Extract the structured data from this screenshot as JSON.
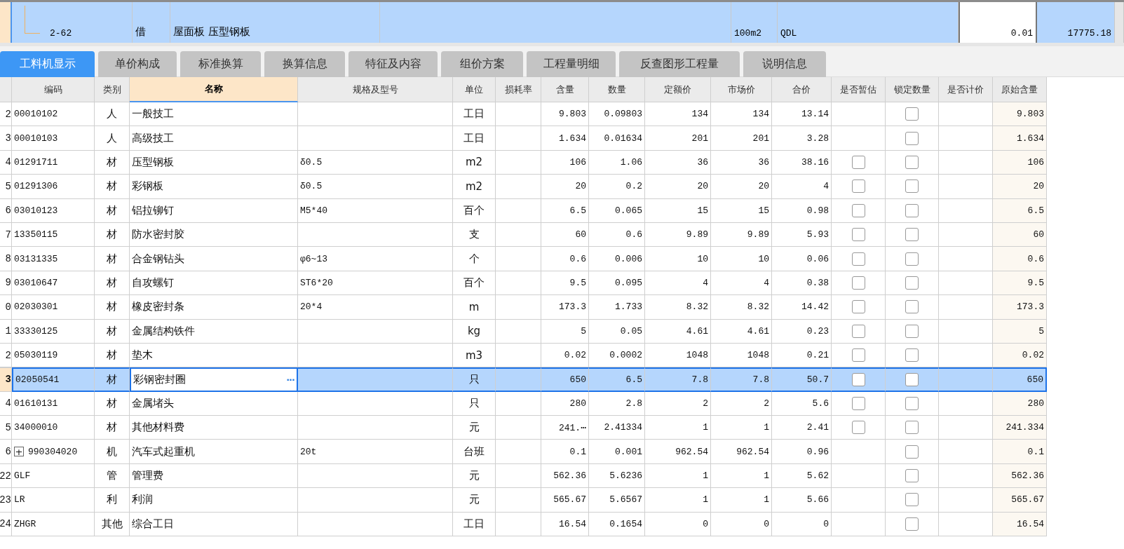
{
  "parent_row": {
    "code": "2-62",
    "type": "借",
    "name": "屋面板 压型钢板",
    "unit": "100m2",
    "column_6": "QDL",
    "column_7": "0.01",
    "column_8": "17775.18"
  },
  "tabs": [
    {
      "label": "工料机显示",
      "selected": true
    },
    {
      "label": "单价构成",
      "selected": false
    },
    {
      "label": "标准换算",
      "selected": false
    },
    {
      "label": "换算信息",
      "selected": false
    },
    {
      "label": "特征及内容",
      "selected": false
    },
    {
      "label": "组价方案",
      "selected": false
    },
    {
      "label": "工程量明细",
      "selected": false
    },
    {
      "label": "反查图形工程量",
      "selected": false
    },
    {
      "label": "说明信息",
      "selected": false
    }
  ],
  "table": {
    "columns": [
      {
        "label": "编码",
        "selected": false
      },
      {
        "label": "类别",
        "selected": false
      },
      {
        "label": "名称",
        "selected": true
      },
      {
        "label": "规格及型号",
        "selected": false
      },
      {
        "label": "单位",
        "selected": false
      },
      {
        "label": "损耗率",
        "selected": false
      },
      {
        "label": "含量",
        "selected": false
      },
      {
        "label": "数量",
        "selected": false
      },
      {
        "label": "定额价",
        "selected": false
      },
      {
        "label": "市场价",
        "selected": false
      },
      {
        "label": "合价",
        "selected": false
      },
      {
        "label": "是否暂估",
        "selected": false
      },
      {
        "label": "锁定数量",
        "selected": false
      },
      {
        "label": "是否计价",
        "selected": false
      },
      {
        "label": "原始含量",
        "selected": false
      }
    ],
    "rows": [
      {
        "number": "2",
        "code": "00010102",
        "type": "人",
        "name": "一般技工",
        "unit": "工日",
        "content": "9.803",
        "quantity": "0.09803",
        "fixed_price": "134",
        "market_price": "134",
        "total": "13.14",
        "lock": false,
        "original": "9.803",
        "selected": false
      },
      {
        "number": "3",
        "code": "00010103",
        "type": "人",
        "name": "高级技工",
        "unit": "工日",
        "content": "1.634",
        "quantity": "0.01634",
        "fixed_price": "201",
        "market_price": "201",
        "total": "3.28",
        "lock": false,
        "original": "1.634",
        "selected": false
      },
      {
        "number": "4",
        "code": "01291711",
        "type": "材",
        "name": "压型钢板",
        "spec": "δ0.5",
        "unit": "m2",
        "content": "106",
        "quantity": "1.06",
        "fixed_price": "36",
        "market_price": "36",
        "total": "38.16",
        "provisional": false,
        "lock": false,
        "original": "106",
        "selected": false
      },
      {
        "number": "5",
        "code": "01291306",
        "type": "材",
        "name": "彩钢板",
        "spec": "δ0.5",
        "unit": "m2",
        "content": "20",
        "quantity": "0.2",
        "fixed_price": "20",
        "market_price": "20",
        "total": "4",
        "provisional": false,
        "lock": false,
        "original": "20",
        "selected": false
      },
      {
        "number": "6",
        "code": "03010123",
        "type": "材",
        "name": "铝拉铆钉",
        "spec": "M5*40",
        "unit": "百个",
        "content": "6.5",
        "quantity": "0.065",
        "fixed_price": "15",
        "market_price": "15",
        "total": "0.98",
        "provisional": false,
        "lock": false,
        "original": "6.5",
        "selected": false
      },
      {
        "number": "7",
        "code": "13350115",
        "type": "材",
        "name": "防水密封胶",
        "unit": "支",
        "content": "60",
        "quantity": "0.6",
        "fixed_price": "9.89",
        "market_price": "9.89",
        "total": "5.93",
        "provisional": false,
        "lock": false,
        "original": "60",
        "selected": false
      },
      {
        "number": "8",
        "code": "03131335",
        "type": "材",
        "name": "合金钢钻头",
        "spec": "φ6~13",
        "unit": "个",
        "content": "0.6",
        "quantity": "0.006",
        "fixed_price": "10",
        "market_price": "10",
        "total": "0.06",
        "provisional": false,
        "lock": false,
        "original": "0.6",
        "selected": false
      },
      {
        "number": "9",
        "code": "03010647",
        "type": "材",
        "name": "自攻螺钉",
        "spec": "ST6*20",
        "unit": "百个",
        "content": "9.5",
        "quantity": "0.095",
        "fixed_price": "4",
        "market_price": "4",
        "total": "0.38",
        "provisional": false,
        "lock": false,
        "original": "9.5",
        "selected": false
      },
      {
        "number": "0",
        "code": "02030301",
        "type": "材",
        "name": "橡皮密封条",
        "spec": "20*4",
        "unit": "m",
        "content": "173.3",
        "quantity": "1.733",
        "fixed_price": "8.32",
        "market_price": "8.32",
        "total": "14.42",
        "provisional": false,
        "lock": false,
        "original": "173.3",
        "selected": false
      },
      {
        "number": "1",
        "code": "33330125",
        "type": "材",
        "name": "金属结构铁件",
        "unit": "kg",
        "content": "5",
        "quantity": "0.05",
        "fixed_price": "4.61",
        "market_price": "4.61",
        "total": "0.23",
        "provisional": false,
        "lock": false,
        "original": "5",
        "selected": false
      },
      {
        "number": "2",
        "code": "05030119",
        "type": "材",
        "name": "垫木",
        "unit": "m3",
        "content": "0.02",
        "quantity": "0.0002",
        "fixed_price": "1048",
        "market_price": "1048",
        "total": "0.21",
        "provisional": false,
        "lock": false,
        "original": "0.02",
        "selected": false
      },
      {
        "number": "3",
        "code": "02050541",
        "type": "材",
        "name": "彩钢密封圈",
        "name_button": "···",
        "unit": "只",
        "content": "650",
        "quantity": "6.5",
        "fixed_price": "7.8",
        "market_price": "7.8",
        "total": "50.7",
        "provisional": false,
        "lock": false,
        "original": "650",
        "selected": true
      },
      {
        "number": "4",
        "code": "01610131",
        "type": "材",
        "name": "金属堵头",
        "unit": "只",
        "content": "280",
        "quantity": "2.8",
        "fixed_price": "2",
        "market_price": "2",
        "total": "5.6",
        "provisional": false,
        "lock": false,
        "original": "280",
        "selected": false
      },
      {
        "number": "5",
        "code": "34000010",
        "type": "材",
        "name": "其他材料费",
        "unit": "元",
        "content": "241.⋯",
        "quantity": "2.41334",
        "fixed_price": "1",
        "market_price": "1",
        "total": "2.41",
        "provisional": false,
        "lock": false,
        "original": "241.334",
        "selected": false
      },
      {
        "number": "6",
        "code": "990304020",
        "expanded": false,
        "expand_sign": "+",
        "type": "机",
        "name": "汽车式起重机",
        "spec": "20t",
        "unit": "台班",
        "content": "0.1",
        "quantity": "0.001",
        "fixed_price": "962.54",
        "market_price": "962.54",
        "total": "0.96",
        "lock": false,
        "original": "0.1",
        "selected": false
      },
      {
        "number": "22",
        "code": "GLF",
        "type": "管",
        "name": "管理费",
        "unit": "元",
        "content": "562.36",
        "quantity": "5.6236",
        "fixed_price": "1",
        "market_price": "1",
        "total": "5.62",
        "lock": false,
        "original": "562.36",
        "selected": false
      },
      {
        "number": "23",
        "code": "LR",
        "type": "利",
        "name": "利润",
        "unit": "元",
        "content": "565.67",
        "quantity": "5.6567",
        "fixed_price": "1",
        "market_price": "1",
        "total": "5.66",
        "lock": false,
        "original": "565.67",
        "selected": false
      },
      {
        "number": "24",
        "code": "ZHGR",
        "type": "其他",
        "name": "综合工日",
        "unit": "工日",
        "content": "16.54",
        "quantity": "0.1654",
        "fixed_price": "0",
        "market_price": "0",
        "total": "0",
        "lock": false,
        "original": "16.54",
        "selected": false
      }
    ]
  }
}
